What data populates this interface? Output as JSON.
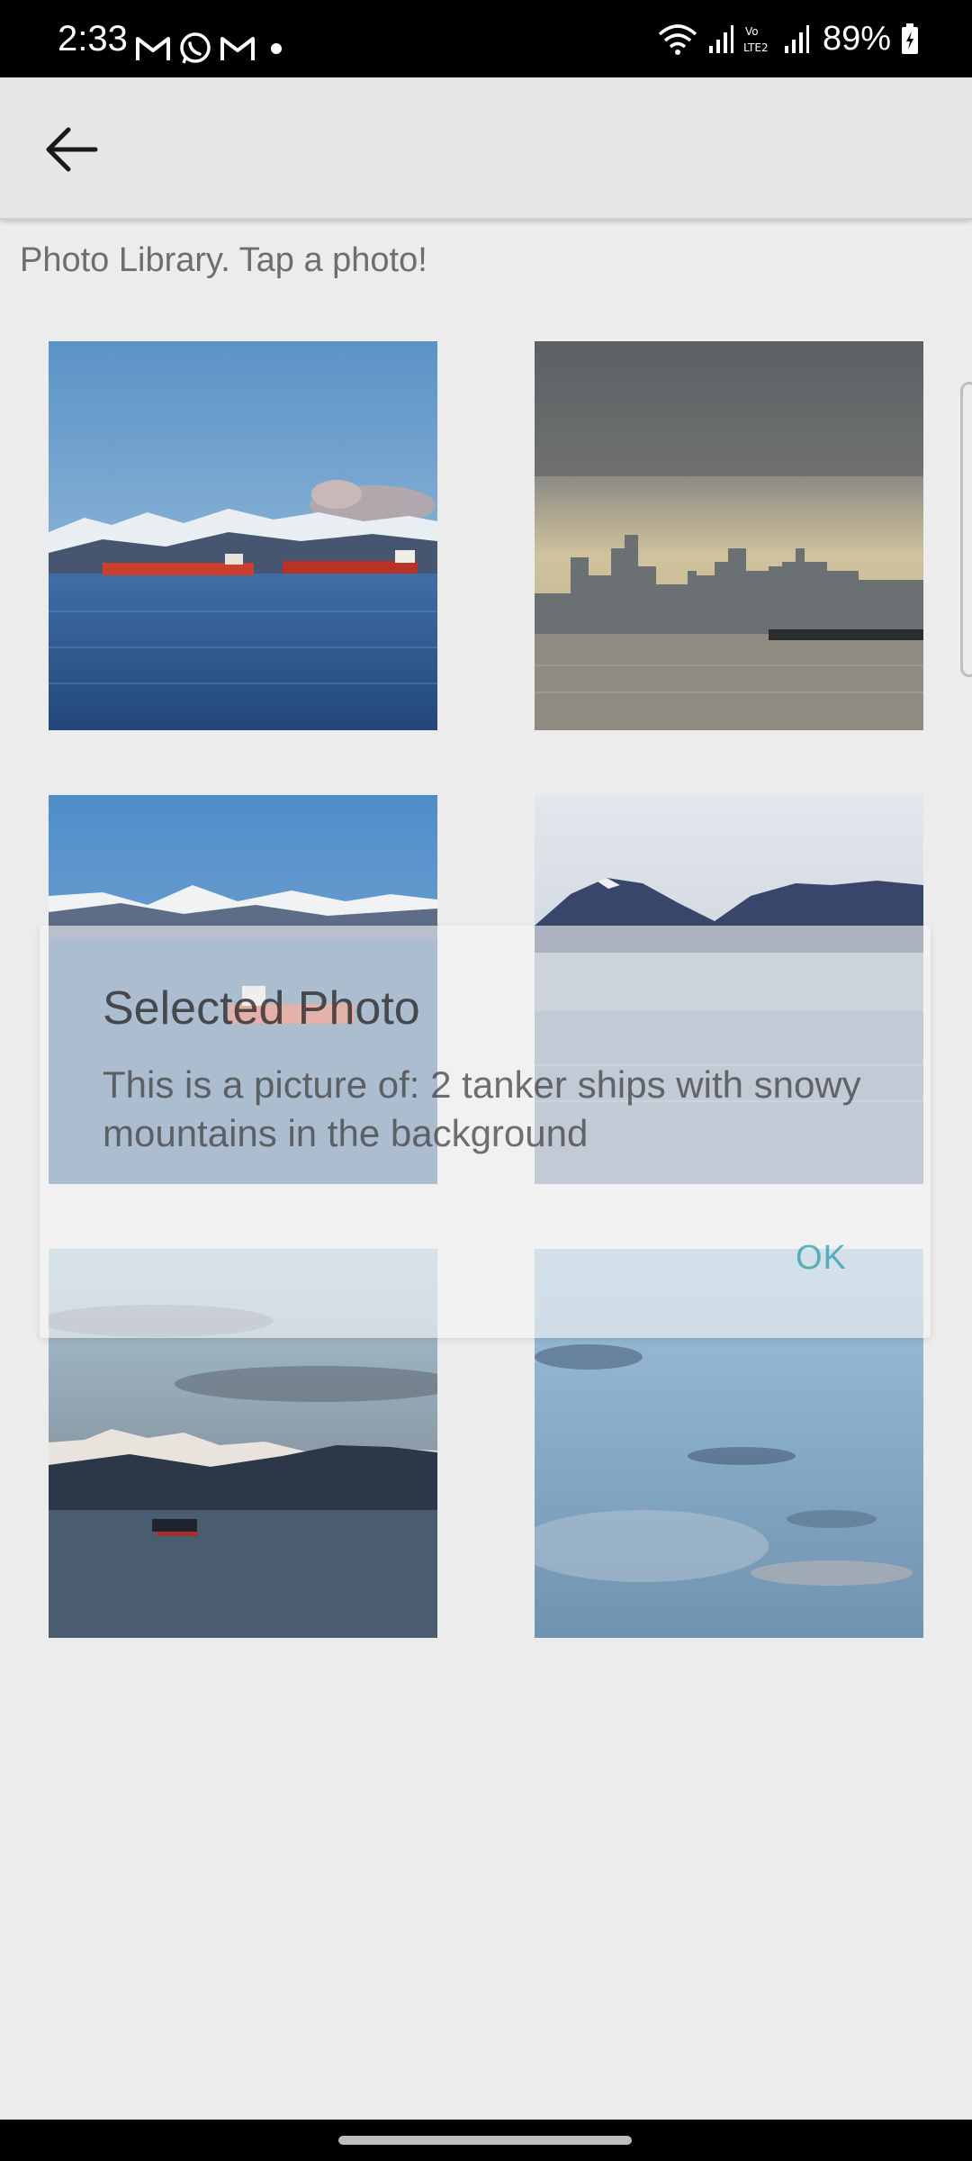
{
  "status_bar": {
    "time": "2:33",
    "battery": "89%",
    "left_icons": [
      "gmail-icon",
      "whatsapp-icon",
      "gmail-icon",
      "dot-icon"
    ],
    "right_icons": [
      "wifi-icon",
      "signal-icon",
      "volte-icon",
      "signal-icon",
      "battery-icon"
    ],
    "volte_label": "Vo LTE2"
  },
  "app_bar": {
    "back_icon": "arrow-left-icon"
  },
  "library_label": "Photo Library. Tap a photo!",
  "photos": [
    {
      "scene": "tanker ships, snowy mountains"
    },
    {
      "scene": "city skyline at dusk"
    },
    {
      "scene": "tanker ship, mountains"
    },
    {
      "scene": "mountain peaks over water"
    },
    {
      "scene": "mountains, ship at sunset"
    },
    {
      "scene": "cloudy sky"
    }
  ],
  "dialog": {
    "title": "Selected Photo",
    "message": "This is a picture of: 2 tanker ships with snowy mountains in the background",
    "ok_label": "OK"
  }
}
